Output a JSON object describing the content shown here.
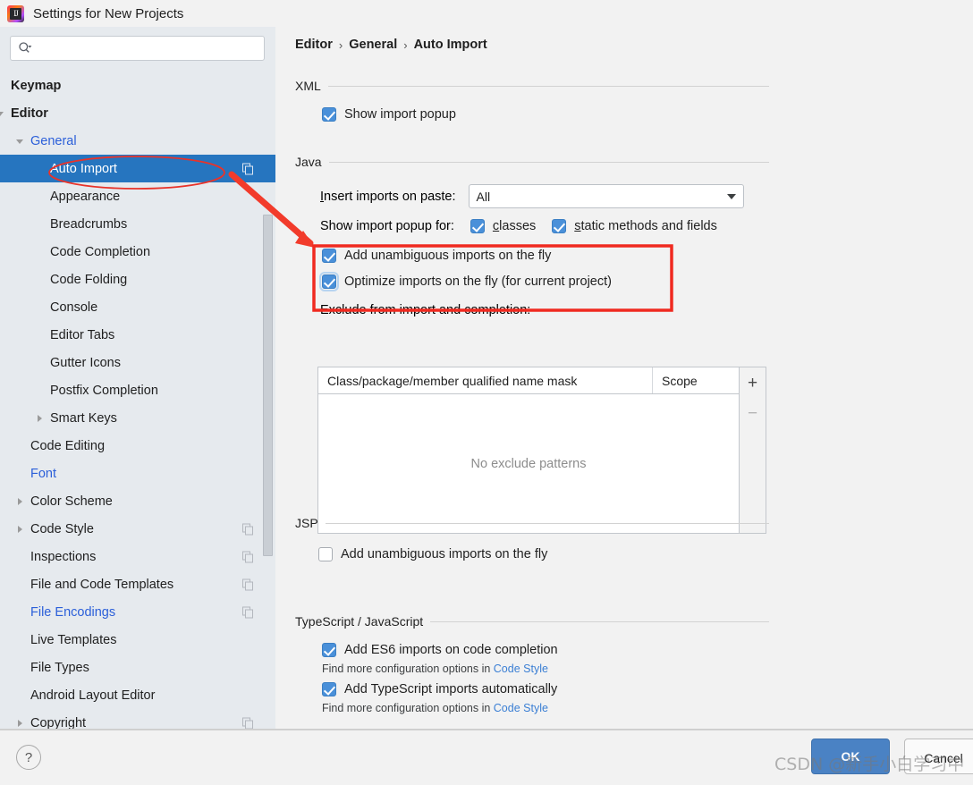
{
  "window": {
    "title": "Settings for New Projects",
    "app_icon": "intellij-idea-logo"
  },
  "search": {
    "value": "",
    "placeholder": "",
    "icon": "search-icon"
  },
  "sidebar": {
    "items": [
      {
        "label": "Keymap",
        "indent": 12,
        "bold": true,
        "twisty": "none",
        "selected": false,
        "link": false,
        "badge": false
      },
      {
        "label": "Editor",
        "indent": 12,
        "bold": true,
        "twisty": "expanded",
        "selected": false,
        "link": false,
        "badge": false
      },
      {
        "label": "General",
        "indent": 34,
        "bold": false,
        "twisty": "expanded",
        "selected": false,
        "link": true,
        "badge": false
      },
      {
        "label": "Auto Import",
        "indent": 56,
        "bold": false,
        "twisty": "none",
        "selected": true,
        "link": false,
        "badge": true
      },
      {
        "label": "Appearance",
        "indent": 56,
        "bold": false,
        "twisty": "none",
        "selected": false,
        "link": false,
        "badge": false
      },
      {
        "label": "Breadcrumbs",
        "indent": 56,
        "bold": false,
        "twisty": "none",
        "selected": false,
        "link": false,
        "badge": false
      },
      {
        "label": "Code Completion",
        "indent": 56,
        "bold": false,
        "twisty": "none",
        "selected": false,
        "link": false,
        "badge": false
      },
      {
        "label": "Code Folding",
        "indent": 56,
        "bold": false,
        "twisty": "none",
        "selected": false,
        "link": false,
        "badge": false
      },
      {
        "label": "Console",
        "indent": 56,
        "bold": false,
        "twisty": "none",
        "selected": false,
        "link": false,
        "badge": false
      },
      {
        "label": "Editor Tabs",
        "indent": 56,
        "bold": false,
        "twisty": "none",
        "selected": false,
        "link": false,
        "badge": false
      },
      {
        "label": "Gutter Icons",
        "indent": 56,
        "bold": false,
        "twisty": "none",
        "selected": false,
        "link": false,
        "badge": false
      },
      {
        "label": "Postfix Completion",
        "indent": 56,
        "bold": false,
        "twisty": "none",
        "selected": false,
        "link": false,
        "badge": false
      },
      {
        "label": "Smart Keys",
        "indent": 56,
        "bold": false,
        "twisty": "collapsed",
        "selected": false,
        "link": false,
        "badge": false
      },
      {
        "label": "Code Editing",
        "indent": 34,
        "bold": false,
        "twisty": "none",
        "selected": false,
        "link": false,
        "badge": false
      },
      {
        "label": "Font",
        "indent": 34,
        "bold": false,
        "twisty": "none",
        "selected": false,
        "link": true,
        "badge": false
      },
      {
        "label": "Color Scheme",
        "indent": 34,
        "bold": false,
        "twisty": "collapsed",
        "selected": false,
        "link": false,
        "badge": false
      },
      {
        "label": "Code Style",
        "indent": 34,
        "bold": false,
        "twisty": "collapsed",
        "selected": false,
        "link": false,
        "badge": true
      },
      {
        "label": "Inspections",
        "indent": 34,
        "bold": false,
        "twisty": "none",
        "selected": false,
        "link": false,
        "badge": true
      },
      {
        "label": "File and Code Templates",
        "indent": 34,
        "bold": false,
        "twisty": "none",
        "selected": false,
        "link": false,
        "badge": true
      },
      {
        "label": "File Encodings",
        "indent": 34,
        "bold": false,
        "twisty": "none",
        "selected": false,
        "link": true,
        "badge": true
      },
      {
        "label": "Live Templates",
        "indent": 34,
        "bold": false,
        "twisty": "none",
        "selected": false,
        "link": false,
        "badge": false
      },
      {
        "label": "File Types",
        "indent": 34,
        "bold": false,
        "twisty": "none",
        "selected": false,
        "link": false,
        "badge": false
      },
      {
        "label": "Android Layout Editor",
        "indent": 34,
        "bold": false,
        "twisty": "none",
        "selected": false,
        "link": false,
        "badge": false
      },
      {
        "label": "Copyright",
        "indent": 34,
        "bold": false,
        "twisty": "collapsed",
        "selected": false,
        "link": false,
        "badge": true
      }
    ]
  },
  "breadcrumb": {
    "items": [
      "Editor",
      "General",
      "Auto Import"
    ],
    "separator": "›"
  },
  "sections": {
    "xml": {
      "title": "XML",
      "show_import_popup": {
        "label": "Show import popup",
        "checked": true
      }
    },
    "java": {
      "title": "Java",
      "insert_imports_label": "Insert imports on paste:",
      "insert_imports_value": "All",
      "show_popup_for_label": "Show import popup for:",
      "classes": {
        "label": "classes",
        "checked": true
      },
      "static_methods": {
        "label": "static methods and fields",
        "checked": true
      },
      "add_unambiguous": {
        "label": "Add unambiguous imports on the fly",
        "checked": true
      },
      "optimize_imports": {
        "label": "Optimize imports on the fly (for current project)",
        "checked": true
      },
      "exclude_label": "Exclude from import and completion:",
      "exclude_table": {
        "columns": [
          "Class/package/member qualified name mask",
          "Scope"
        ],
        "rows": [],
        "empty_text": "No exclude patterns",
        "add_button": "+",
        "remove_button": "−"
      }
    },
    "jsp": {
      "title": "JSP",
      "add_unambiguous": {
        "label": "Add unambiguous imports on the fly",
        "checked": false
      }
    },
    "typescript": {
      "title": "TypeScript / JavaScript",
      "add_es6": {
        "label": "Add ES6 imports on code completion",
        "checked": true
      },
      "add_es6_hint_prefix": "Find more configuration options in ",
      "add_es6_hint_link": "Code Style",
      "add_ts": {
        "label": "Add TypeScript imports automatically",
        "checked": true
      },
      "add_ts_hint_prefix": "Find more configuration options in ",
      "add_ts_hint_link": "Code Style"
    }
  },
  "footer": {
    "help_label": "?",
    "ok_label": "OK",
    "cancel_label": "Cancel"
  },
  "watermark": {
    "text": "CSDN @新手小白学习中"
  },
  "annotations": {
    "ellipse_target": "Auto Import",
    "rect_target": "Add unambiguous / Optimize imports on the fly",
    "color": "#e8332a"
  }
}
